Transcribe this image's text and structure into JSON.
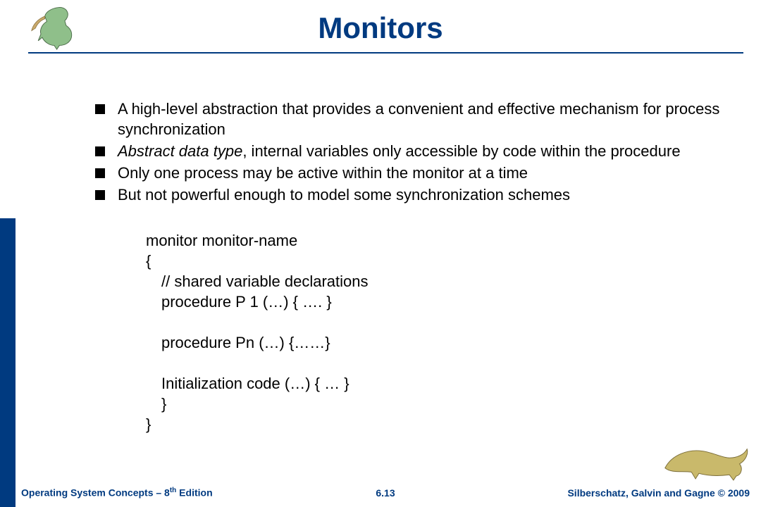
{
  "title": "Monitors",
  "bullets": [
    {
      "text": "A high-level abstraction that provides a convenient and effective mechanism for process synchronization"
    },
    {
      "html": "<i>Abstract data type</i>, internal variables only accessible by code within the procedure"
    },
    {
      "text": "Only one process may be active within the monitor at a time"
    },
    {
      "text": "But not powerful enough to model some synchronization schemes"
    }
  ],
  "code": {
    "l1": "monitor monitor-name",
    "l2": "{",
    "l3": "// shared variable declarations",
    "l4": "procedure P 1 (…) { …. }",
    "l5": "procedure Pn (…) {……}",
    "l6": "Initialization code (…) { … }",
    "l7": "}",
    "l8": "}"
  },
  "footer": {
    "left_a": "Operating System Concepts – 8",
    "left_sup": "th",
    "left_b": " Edition",
    "mid": "6.13",
    "right": "Silberschatz, Galvin and Gagne © 2009"
  },
  "icons": {
    "dino_top": "dinosaur-upright",
    "dino_bottom": "dinosaur-crawling"
  }
}
